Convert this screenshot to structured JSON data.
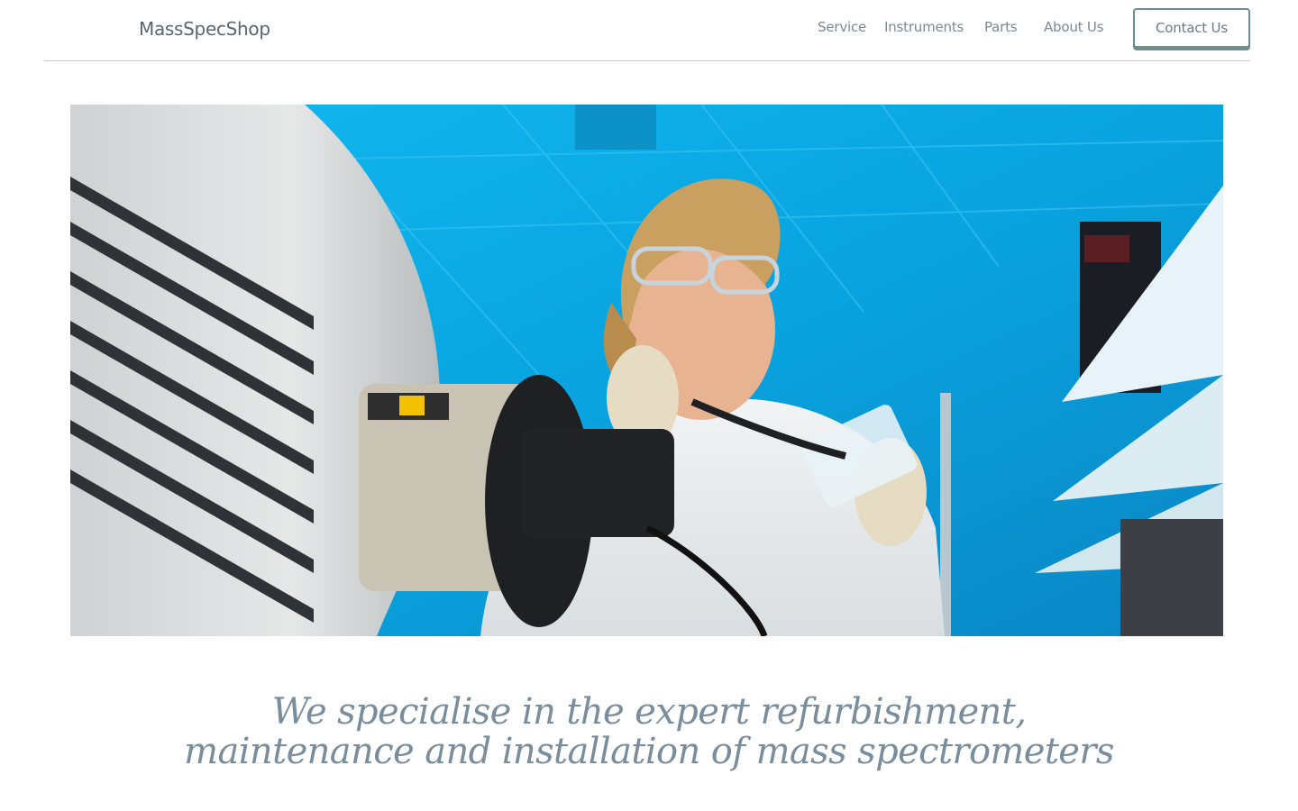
{
  "brand": {
    "name": "MassSpecShop"
  },
  "nav": {
    "items": [
      {
        "label": "Service"
      },
      {
        "label": "Instruments"
      },
      {
        "label": "Parts"
      },
      {
        "label": "About Us"
      }
    ],
    "cta_label": "Contact Us"
  },
  "hero": {
    "image": "photo of a lab scientist in safety glasses and gloves working at a mass spectrometer ion source, blue laboratory background"
  },
  "tagline": {
    "line1": "We specialise in the expert refurbishment,",
    "line2": "maintenance and installation of mass spectrometers"
  },
  "colors": {
    "text_muted": "#7d8891",
    "logo": "#5a6670",
    "button_border": "#6e8f92",
    "tagline": "#7a8d9c",
    "lab_blue": "#0aa7e0"
  }
}
